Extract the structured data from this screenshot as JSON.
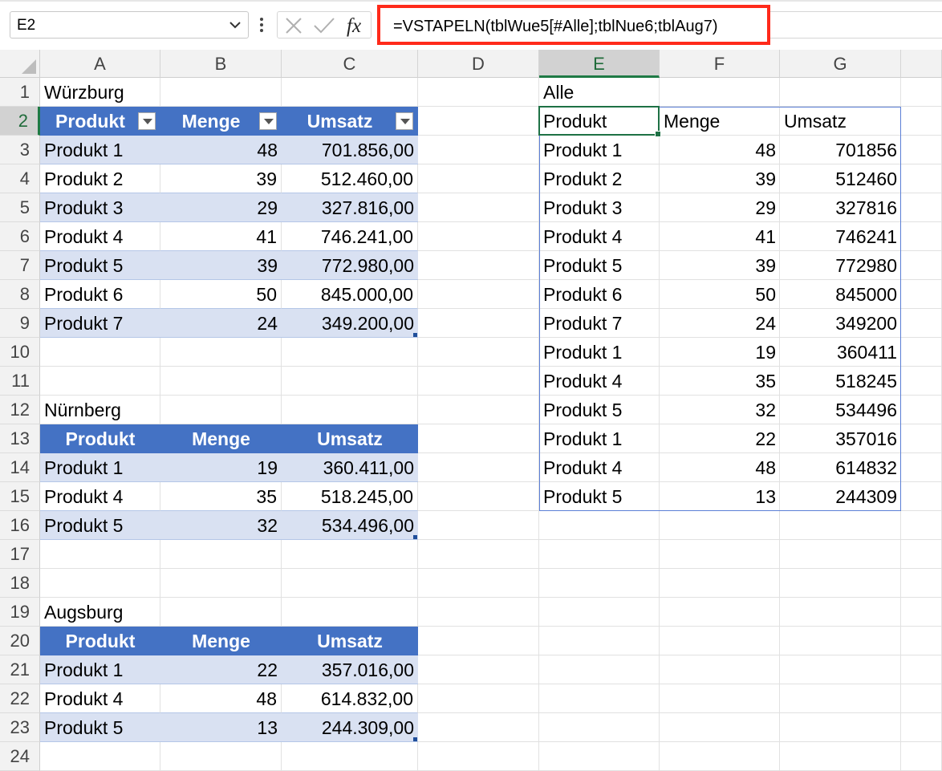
{
  "formula_bar": {
    "name_box": "E2",
    "formula": "=VSTAPELN(tblWue5[#Alle];tblNue6;tblAug7)",
    "fx_label": "fx"
  },
  "columns": [
    "A",
    "B",
    "C",
    "D",
    "E",
    "F",
    "G"
  ],
  "rows": [
    "1",
    "2",
    "3",
    "4",
    "5",
    "6",
    "7",
    "8",
    "9",
    "10",
    "11",
    "12",
    "13",
    "14",
    "15",
    "16",
    "17",
    "18",
    "19",
    "20",
    "21",
    "22",
    "23",
    "24"
  ],
  "tables": {
    "wuerzburg": {
      "title": "Würzburg",
      "headers": [
        "Produkt",
        "Menge",
        "Umsatz"
      ],
      "rows": [
        [
          "Produkt 1",
          "48",
          "701.856,00"
        ],
        [
          "Produkt 2",
          "39",
          "512.460,00"
        ],
        [
          "Produkt 3",
          "29",
          "327.816,00"
        ],
        [
          "Produkt 4",
          "41",
          "746.241,00"
        ],
        [
          "Produkt 5",
          "39",
          "772.980,00"
        ],
        [
          "Produkt 6",
          "50",
          "845.000,00"
        ],
        [
          "Produkt 7",
          "24",
          "349.200,00"
        ]
      ]
    },
    "nuernberg": {
      "title": "Nürnberg",
      "headers": [
        "Produkt",
        "Menge",
        "Umsatz"
      ],
      "rows": [
        [
          "Produkt 1",
          "19",
          "360.411,00"
        ],
        [
          "Produkt 4",
          "35",
          "518.245,00"
        ],
        [
          "Produkt 5",
          "32",
          "534.496,00"
        ]
      ]
    },
    "augsburg": {
      "title": "Augsburg",
      "headers": [
        "Produkt",
        "Menge",
        "Umsatz"
      ],
      "rows": [
        [
          "Produkt 1",
          "22",
          "357.016,00"
        ],
        [
          "Produkt 4",
          "48",
          "614.832,00"
        ],
        [
          "Produkt 5",
          "13",
          "244.309,00"
        ]
      ]
    }
  },
  "spill": {
    "title": "Alle",
    "headers": [
      "Produkt",
      "Menge",
      "Umsatz"
    ],
    "rows": [
      [
        "Produkt 1",
        "48",
        "701856"
      ],
      [
        "Produkt 2",
        "39",
        "512460"
      ],
      [
        "Produkt 3",
        "29",
        "327816"
      ],
      [
        "Produkt 4",
        "41",
        "746241"
      ],
      [
        "Produkt 5",
        "39",
        "772980"
      ],
      [
        "Produkt 6",
        "50",
        "845000"
      ],
      [
        "Produkt 7",
        "24",
        "349200"
      ],
      [
        "Produkt 1",
        "19",
        "360411"
      ],
      [
        "Produkt 4",
        "35",
        "518245"
      ],
      [
        "Produkt 5",
        "32",
        "534496"
      ],
      [
        "Produkt 1",
        "22",
        "357016"
      ],
      [
        "Produkt 4",
        "48",
        "614832"
      ],
      [
        "Produkt 5",
        "13",
        "244309"
      ]
    ]
  },
  "colors": {
    "table_header": "#4472c4",
    "band": "#d9e1f2",
    "formula_highlight": "#ff2a1a",
    "active_cell": "#1e7145"
  }
}
